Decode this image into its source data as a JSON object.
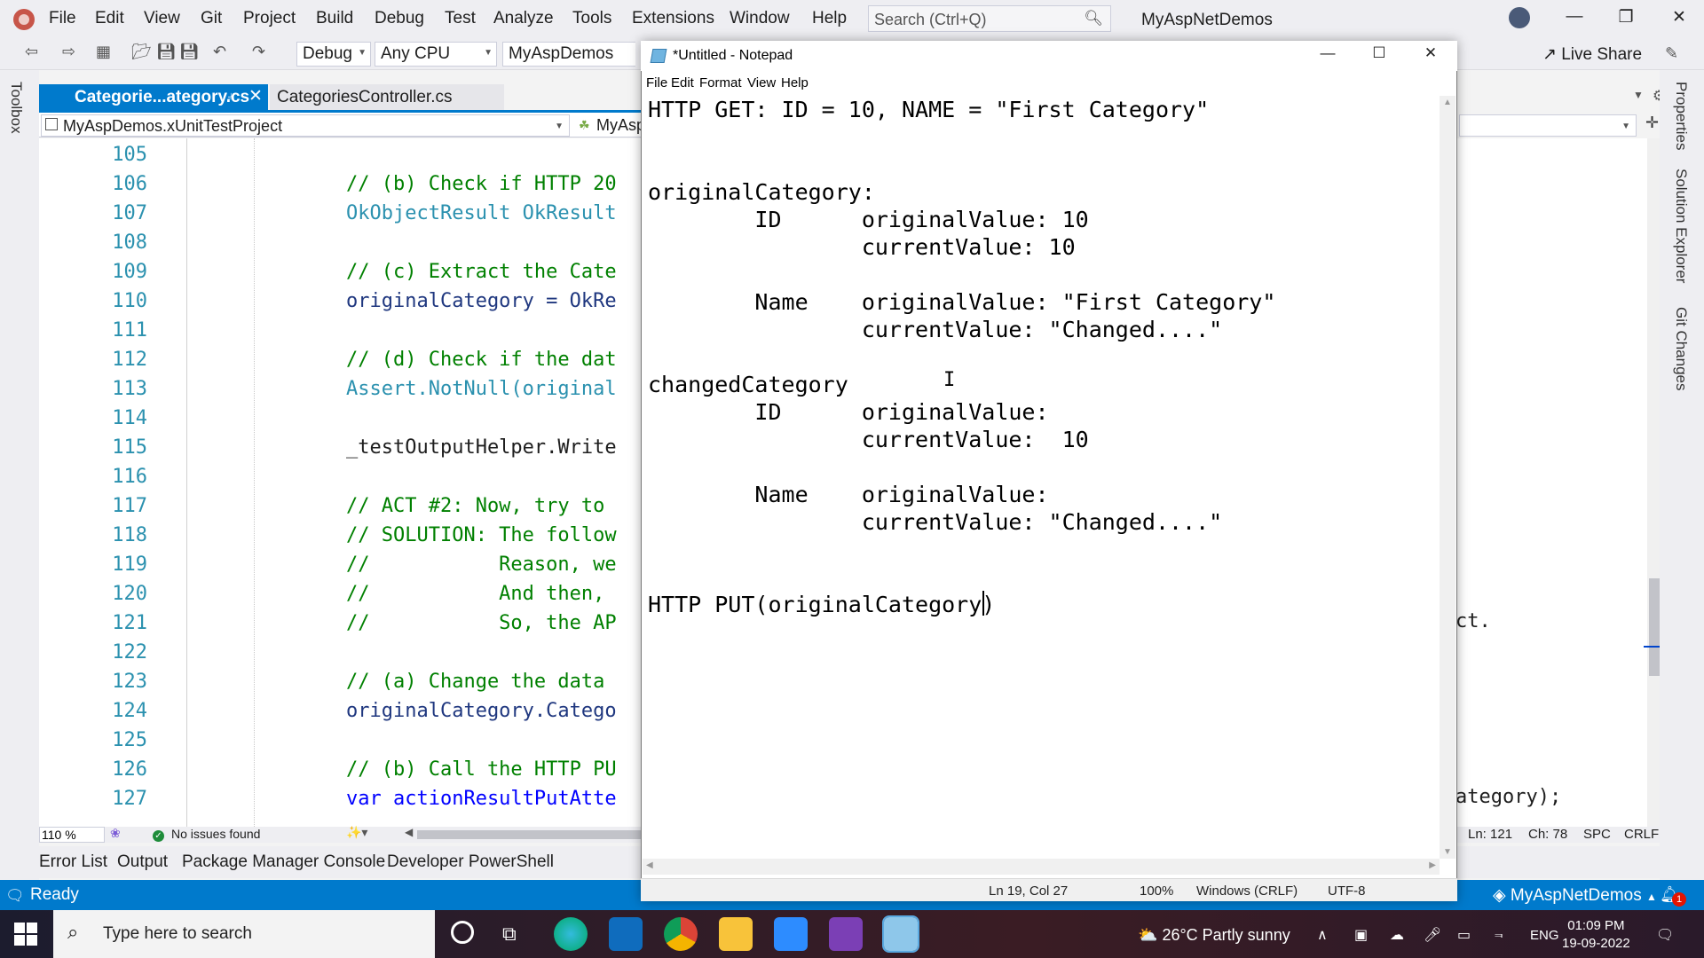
{
  "vs": {
    "menus": [
      "File",
      "Edit",
      "View",
      "Git",
      "Project",
      "Build",
      "Debug",
      "Test",
      "Analyze",
      "Tools",
      "Extensions",
      "Window",
      "Help"
    ],
    "search_placeholder": "Search (Ctrl+Q)",
    "solution_title": "MyAspNetDemos",
    "toolbar": {
      "config": "Debug",
      "platform": "Any CPU",
      "startup": "MyAspDemos",
      "live_share": "Live Share"
    },
    "toolbox_label": "Toolbox",
    "tabs": [
      {
        "label": "Categorie...ategory.cs",
        "active": true
      },
      {
        "label": "CategoriesController.cs",
        "active": false
      }
    ],
    "nav": {
      "project": "MyAspDemos.xUnitTestProject",
      "member": "MyAsp"
    },
    "code_lines": [
      {
        "num": "105",
        "text": ""
      },
      {
        "num": "106",
        "text": "// (b) Check if HTTP 20"
      },
      {
        "num": "107",
        "text": "OkObjectResult OkResult"
      },
      {
        "num": "108",
        "text": ""
      },
      {
        "num": "109",
        "text": "// (c) Extract the Cate"
      },
      {
        "num": "110",
        "text": "originalCategory = OkRe"
      },
      {
        "num": "111",
        "text": ""
      },
      {
        "num": "112",
        "text": "// (d) Check if the dat"
      },
      {
        "num": "113",
        "text": "Assert.NotNull(original"
      },
      {
        "num": "114",
        "text": ""
      },
      {
        "num": "115",
        "text": "_testOutputHelper.Write"
      },
      {
        "num": "116",
        "text": ""
      },
      {
        "num": "117",
        "text": "// ACT #2: Now, try to "
      },
      {
        "num": "118",
        "text": "// SOLUTION: The follow"
      },
      {
        "num": "119",
        "text": "//           Reason, we"
      },
      {
        "num": "120",
        "text": "//           And then, "
      },
      {
        "num": "121",
        "text": "//           So, the AP"
      },
      {
        "num": "122",
        "text": ""
      },
      {
        "num": "123",
        "text": "// (a) Change the data "
      },
      {
        "num": "124",
        "text": "originalCategory.Catego"
      },
      {
        "num": "125",
        "text": ""
      },
      {
        "num": "126",
        "text": "// (b) Call the HTTP PU"
      },
      {
        "num": "127",
        "text": "var actionResultPutAtte"
      }
    ],
    "right_code_121": "ct.",
    "right_code_127": "ategory);",
    "zoom": "110 %",
    "issues": "No issues found",
    "cursor": {
      "ln": "Ln: 121",
      "ch": "Ch: 78",
      "spc": "SPC",
      "eol": "CRLF"
    },
    "bottom_tabs": [
      "Error List",
      "Output",
      "Package Manager Console",
      "Developer PowerShell"
    ],
    "status": {
      "ready": "Ready",
      "repo": "MyAspNetDemos",
      "notifications": "1"
    },
    "right_tabs": [
      "Properties",
      "Solution Explorer",
      "Git Changes"
    ]
  },
  "notepad": {
    "title": "*Untitled - Notepad",
    "menus": [
      "File",
      "Edit",
      "Format",
      "View",
      "Help"
    ],
    "content": "HTTP GET: ID = 10, NAME = \"First Category\"\n\n\noriginalCategory:\n        ID      originalValue: 10\n                currentValue: 10\n\n        Name    originalValue: \"First Category\"\n                currentValue: \"Changed....\"\n\nchangedCategory\n        ID      originalValue:\n                currentValue:  10\n\n        Name    originalValue:\n                currentValue: \"Changed....\"\n\n\nHTTP PUT(originalCategory)",
    "status": {
      "position": "Ln 19, Col 27",
      "zoom": "100%",
      "eol": "Windows (CRLF)",
      "encoding": "UTF-8"
    }
  },
  "taskbar": {
    "search_placeholder": "Type here to search",
    "weather": "26°C  Partly sunny",
    "lang": "ENG",
    "time": "01:09 PM",
    "date": "19-09-2022"
  }
}
